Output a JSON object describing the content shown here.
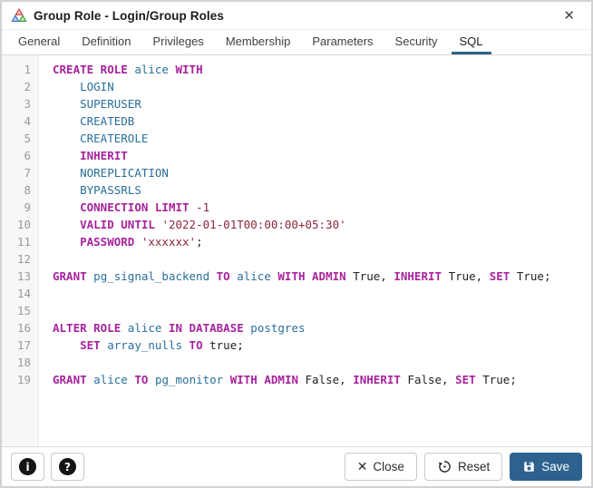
{
  "window": {
    "title": "Group Role - Login/Group Roles",
    "close_glyph": "✕"
  },
  "icons": {
    "titlebar": "group-role-icon",
    "footer_left": [
      "info-icon",
      "help-icon"
    ],
    "info_glyph": "i",
    "help_glyph": "?"
  },
  "colors": {
    "primary": "#2d628f",
    "tab_underline": "#2c6387",
    "keyword": "#a8239e",
    "identifier": "#2a6f9b",
    "literal": "#8c283c",
    "gutter_bg": "#f7f7f7",
    "line_number": "#999999"
  },
  "tabs": {
    "active": "SQL",
    "items": [
      "General",
      "Definition",
      "Privileges",
      "Membership",
      "Parameters",
      "Security",
      "SQL"
    ]
  },
  "editor": {
    "lines": [
      {
        "n": 1,
        "seg": [
          [
            "k",
            "CREATE ROLE"
          ],
          [
            "p",
            " "
          ],
          [
            "b",
            "alice"
          ],
          [
            "p",
            " "
          ],
          [
            "k",
            "WITH"
          ]
        ]
      },
      {
        "n": 2,
        "seg": [
          [
            "p",
            "    "
          ],
          [
            "b",
            "LOGIN"
          ]
        ]
      },
      {
        "n": 3,
        "seg": [
          [
            "p",
            "    "
          ],
          [
            "b",
            "SUPERUSER"
          ]
        ]
      },
      {
        "n": 4,
        "seg": [
          [
            "p",
            "    "
          ],
          [
            "b",
            "CREATEDB"
          ]
        ]
      },
      {
        "n": 5,
        "seg": [
          [
            "p",
            "    "
          ],
          [
            "b",
            "CREATEROLE"
          ]
        ]
      },
      {
        "n": 6,
        "seg": [
          [
            "p",
            "    "
          ],
          [
            "k",
            "INHERIT"
          ]
        ]
      },
      {
        "n": 7,
        "seg": [
          [
            "p",
            "    "
          ],
          [
            "b",
            "NOREPLICATION"
          ]
        ]
      },
      {
        "n": 8,
        "seg": [
          [
            "p",
            "    "
          ],
          [
            "b",
            "BYPASSRLS"
          ]
        ]
      },
      {
        "n": 9,
        "seg": [
          [
            "p",
            "    "
          ],
          [
            "k",
            "CONNECTION LIMIT"
          ],
          [
            "p",
            " "
          ],
          [
            "s",
            "-1"
          ]
        ]
      },
      {
        "n": 10,
        "seg": [
          [
            "p",
            "    "
          ],
          [
            "k",
            "VALID UNTIL"
          ],
          [
            "p",
            " "
          ],
          [
            "s",
            "'2022-01-01T00:00:00+05:30'"
          ]
        ]
      },
      {
        "n": 11,
        "seg": [
          [
            "p",
            "    "
          ],
          [
            "k",
            "PASSWORD"
          ],
          [
            "p",
            " "
          ],
          [
            "s",
            "'xxxxxx'"
          ],
          [
            "p",
            ";"
          ]
        ]
      },
      {
        "n": 12,
        "seg": []
      },
      {
        "n": 13,
        "seg": [
          [
            "k",
            "GRANT"
          ],
          [
            "p",
            " "
          ],
          [
            "b",
            "pg_signal_backend"
          ],
          [
            "p",
            " "
          ],
          [
            "k",
            "TO"
          ],
          [
            "p",
            " "
          ],
          [
            "b",
            "alice"
          ],
          [
            "p",
            " "
          ],
          [
            "k",
            "WITH ADMIN"
          ],
          [
            "p",
            " True, "
          ],
          [
            "k",
            "INHERIT"
          ],
          [
            "p",
            " True, "
          ],
          [
            "k",
            "SET"
          ],
          [
            "p",
            " True;"
          ]
        ]
      },
      {
        "n": 14,
        "seg": []
      },
      {
        "n": 15,
        "seg": []
      },
      {
        "n": 16,
        "seg": [
          [
            "k",
            "ALTER ROLE"
          ],
          [
            "p",
            " "
          ],
          [
            "b",
            "alice"
          ],
          [
            "p",
            " "
          ],
          [
            "k",
            "IN DATABASE"
          ],
          [
            "p",
            " "
          ],
          [
            "b",
            "postgres"
          ]
        ]
      },
      {
        "n": 17,
        "seg": [
          [
            "p",
            "    "
          ],
          [
            "k",
            "SET"
          ],
          [
            "p",
            " "
          ],
          [
            "b",
            "array_nulls"
          ],
          [
            "p",
            " "
          ],
          [
            "k",
            "TO"
          ],
          [
            "p",
            " true;"
          ]
        ]
      },
      {
        "n": 18,
        "seg": []
      },
      {
        "n": 19,
        "seg": [
          [
            "k",
            "GRANT"
          ],
          [
            "p",
            " "
          ],
          [
            "b",
            "alice"
          ],
          [
            "p",
            " "
          ],
          [
            "k",
            "TO"
          ],
          [
            "p",
            " "
          ],
          [
            "b",
            "pg_monitor"
          ],
          [
            "p",
            " "
          ],
          [
            "k",
            "WITH ADMIN"
          ],
          [
            "p",
            " False, "
          ],
          [
            "k",
            "INHERIT"
          ],
          [
            "p",
            " False, "
          ],
          [
            "k",
            "SET"
          ],
          [
            "p",
            " True;"
          ]
        ]
      }
    ]
  },
  "footer": {
    "close_label": "Close",
    "close_glyph": "✕",
    "reset_label": "Reset",
    "save_label": "Save"
  }
}
